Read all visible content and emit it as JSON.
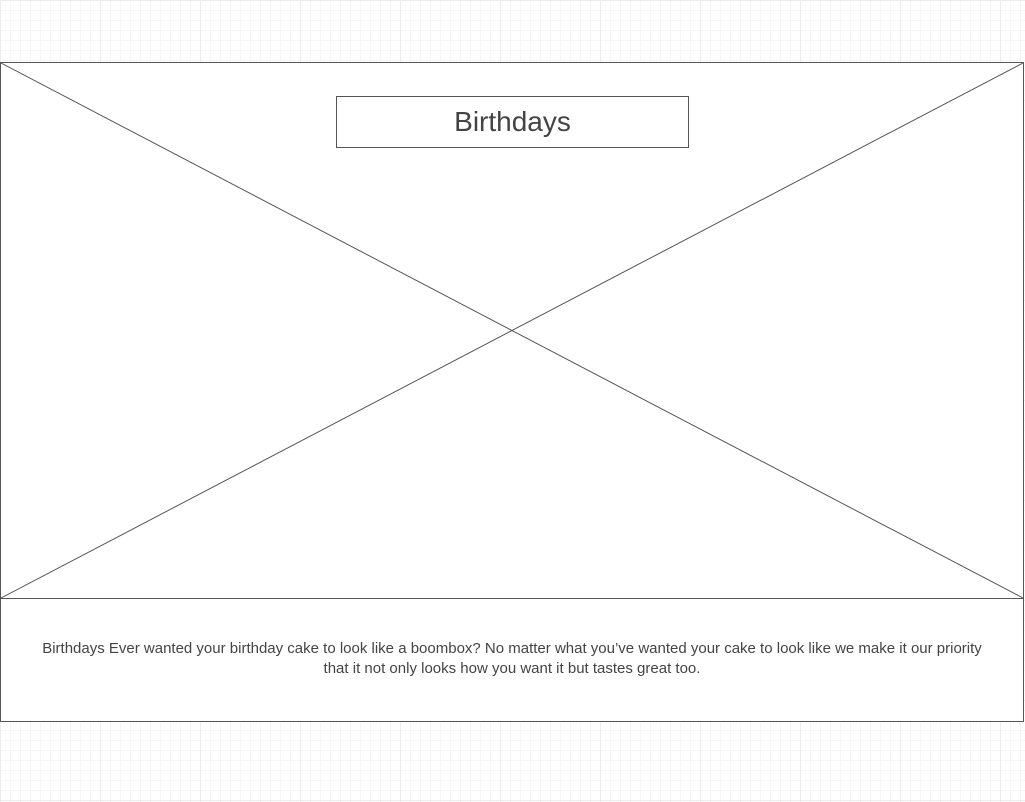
{
  "hero": {
    "title": "Birthdays",
    "description": "Birthdays Ever wanted your birthday cake to look like a boombox? No matter what you’ve wanted your cake to look like we make it our priority that it not only looks how you want it but tastes great too."
  },
  "colors": {
    "stroke": "#555555",
    "text": "#444444",
    "grid": "#ececec",
    "background": "#ffffff"
  },
  "icons": {
    "image_placeholder": "image-placeholder-cross-icon"
  }
}
